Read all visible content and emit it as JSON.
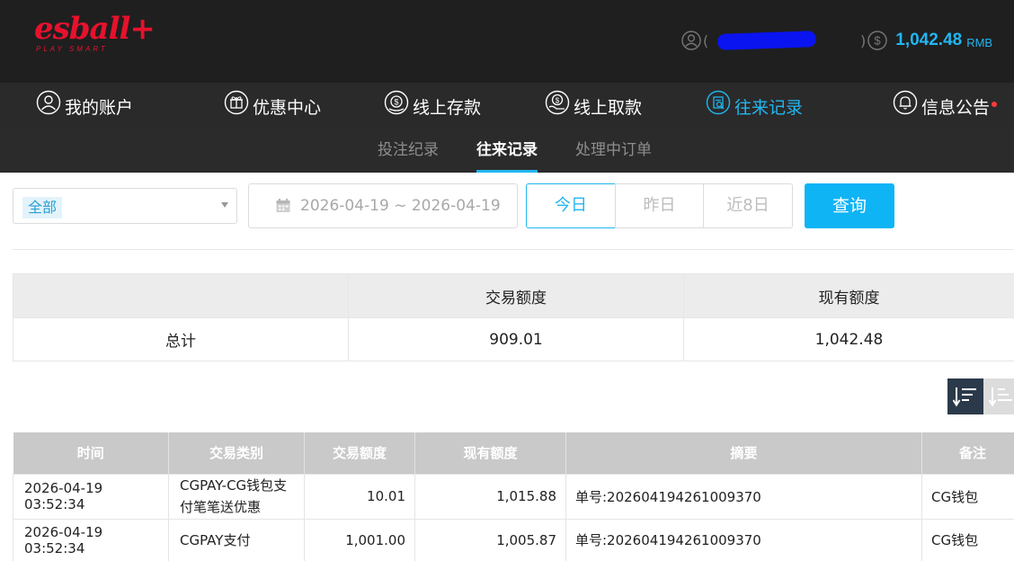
{
  "brand": {
    "logo": "esball+",
    "tagline": "PLAY SMART"
  },
  "header": {
    "balance": "1,042.48",
    "currency": "RMB"
  },
  "main_nav": [
    {
      "label": "我的账户",
      "icon": "user-icon"
    },
    {
      "label": "优惠中心",
      "icon": "gift-icon"
    },
    {
      "label": "线上存款",
      "icon": "deposit-icon"
    },
    {
      "label": "线上取款",
      "icon": "withdraw-icon"
    },
    {
      "label": "往来记录",
      "icon": "records-icon",
      "active": true
    },
    {
      "label": "信息公告",
      "icon": "bell-icon",
      "badge": true
    }
  ],
  "sub_nav": [
    {
      "label": "投注纪录"
    },
    {
      "label": "往来记录",
      "active": true
    },
    {
      "label": "处理中订单"
    }
  ],
  "filter": {
    "type_selected": "全部",
    "date_range": "2026-04-19 ~ 2026-04-19",
    "quick_ranges": [
      "今日",
      "昨日",
      "近8日"
    ],
    "query_label": "查询"
  },
  "summary": {
    "headers": [
      "",
      "交易额度",
      "现有额度"
    ],
    "row": {
      "label": "总计",
      "transaction": "909.01",
      "balance": "1,042.48"
    }
  },
  "records": {
    "headers": [
      "时间",
      "交易类别",
      "交易额度",
      "现有额度",
      "摘要",
      "备注"
    ],
    "rows": [
      {
        "time": "2026-04-19 03:52:34",
        "type": "CGPAY-CG钱包支付笔笔送优惠",
        "amount": "10.01",
        "balance": "1,015.88",
        "summary": "单号:202604194261009370",
        "note": "CG钱包"
      },
      {
        "time": "2026-04-19 03:52:34",
        "type": "CGPAY支付",
        "amount": "1,001.00",
        "balance": "1,005.87",
        "summary": "单号:202604194261009370",
        "note": "CG钱包"
      }
    ]
  },
  "colors": {
    "accent": "#22b6f0",
    "brand_red": "#e8112d",
    "header_bg": "#1f1f1f",
    "nav_bg": "#2a2a2a",
    "sort_active": "#2b3a4a"
  }
}
